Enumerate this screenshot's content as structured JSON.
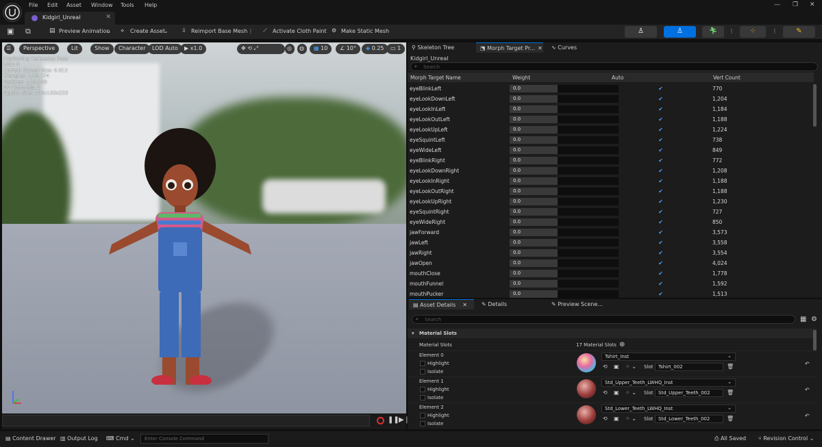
{
  "menu": [
    "File",
    "Edit",
    "Asset",
    "Window",
    "Tools",
    "Help"
  ],
  "doc_tab": "Kidgirl_Unreal",
  "toolbar": {
    "preview_animation": "Preview Animation",
    "create_asset": "Create Asset",
    "reimport": "Reimport Base Mesh",
    "cloth_paint": "Activate Cloth Paint",
    "static_mesh": "Make Static Mesh"
  },
  "viewport": {
    "perspective": "Perspective",
    "lit": "Lit",
    "show": "Show",
    "character": "Character",
    "lod": "LOD Auto",
    "speed": "x1.0",
    "grid": "10",
    "angle": "10°",
    "scale": "0.25",
    "cams": "1",
    "stats": [
      "Previewing Reference Pose",
      "LOD: 0",
      "Current Screen Size: 0.912",
      "Triangles: 3,00,174",
      "Vertices: 2,20,928",
      "UV Channels: 2",
      "Approx Size: 149x135x233"
    ]
  },
  "right_tabs": [
    "Skeleton Tree",
    "Morph Target Pr...",
    "Curves"
  ],
  "asset_name": "Kidgirl_Unreal",
  "search_placeholder": "Search",
  "morph_table": {
    "headers": [
      "Morph Target Name",
      "Weight",
      "Auto",
      "Vert Count"
    ],
    "rows": [
      {
        "name": "eyeBlinkLeft",
        "weight": "0.0",
        "count": "770"
      },
      {
        "name": "eyeLookDownLeft",
        "weight": "0.0",
        "count": "1,204"
      },
      {
        "name": "eyeLookInLeft",
        "weight": "0.0",
        "count": "1,184"
      },
      {
        "name": "eyeLookOutLeft",
        "weight": "0.0",
        "count": "1,188"
      },
      {
        "name": "eyeLookUpLeft",
        "weight": "0.0",
        "count": "1,224"
      },
      {
        "name": "eyeSquintLeft",
        "weight": "0.0",
        "count": "738"
      },
      {
        "name": "eyeWideLeft",
        "weight": "0.0",
        "count": "849"
      },
      {
        "name": "eyeBlinkRight",
        "weight": "0.0",
        "count": "772"
      },
      {
        "name": "eyeLookDownRight",
        "weight": "0.0",
        "count": "1,208"
      },
      {
        "name": "eyeLookInRight",
        "weight": "0.0",
        "count": "1,188"
      },
      {
        "name": "eyeLookOutRight",
        "weight": "0.0",
        "count": "1,188"
      },
      {
        "name": "eyeLookUpRight",
        "weight": "0.0",
        "count": "1,230"
      },
      {
        "name": "eyeSquintRight",
        "weight": "0.0",
        "count": "727"
      },
      {
        "name": "eyeWideRight",
        "weight": "0.0",
        "count": "850"
      },
      {
        "name": "jawForward",
        "weight": "0.0",
        "count": "3,573"
      },
      {
        "name": "jawLeft",
        "weight": "0.0",
        "count": "3,558"
      },
      {
        "name": "jawRight",
        "weight": "0.0",
        "count": "3,554"
      },
      {
        "name": "jawOpen",
        "weight": "0.0",
        "count": "4,024"
      },
      {
        "name": "mouthClose",
        "weight": "0.0",
        "count": "1,778"
      },
      {
        "name": "mouthFunnel",
        "weight": "0.0",
        "count": "1,592"
      },
      {
        "name": "mouthPucker",
        "weight": "0.0",
        "count": "1,513"
      }
    ]
  },
  "bottom_tabs": [
    "Asset Details",
    "Details",
    "Preview Scene..."
  ],
  "material_slots": {
    "section": "Material Slots",
    "label": "Material Slots",
    "count": "17 Material Slots",
    "highlight": "Highlight",
    "isolate": "Isolate",
    "slot_label": "Slot",
    "elements": [
      {
        "name": "Element 0",
        "material": "Tshirt_Inst",
        "slot": "Tshirt_002"
      },
      {
        "name": "Element 1",
        "material": "Std_Upper_Teeth_LWHQ_Inst",
        "slot": "Std_Upper_Teeth_002"
      },
      {
        "name": "Element 2",
        "material": "Std_Lower_Teeth_LWHQ_Inst",
        "slot": "Std_Lower_Teeth_002"
      }
    ]
  },
  "status": {
    "content_drawer": "Content Drawer",
    "output_log": "Output Log",
    "cmd": "Cmd",
    "console_placeholder": "Enter Console Command",
    "all_saved": "All Saved",
    "revision": "Revision Control"
  },
  "colors": {
    "accent": "#0070e0",
    "check": "#4aa3ff"
  }
}
